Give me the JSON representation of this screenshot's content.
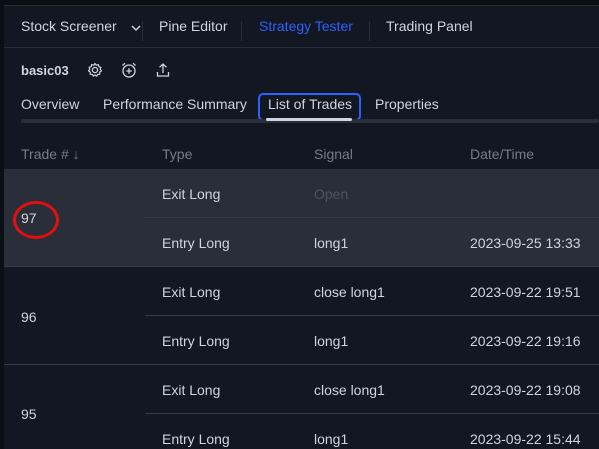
{
  "topnav": {
    "items": [
      {
        "label": "Stock Screener",
        "has_dropdown": true,
        "active": false
      },
      {
        "label": "Pine Editor",
        "active": false
      },
      {
        "label": "Strategy Tester",
        "active": true
      },
      {
        "label": "Trading Panel",
        "active": false
      }
    ],
    "active_color": "#2962ff"
  },
  "strategy": {
    "name": "basic03",
    "icons": [
      "settings-gear-icon",
      "alarm-clock-plus-icon",
      "share-upload-icon"
    ]
  },
  "tabs": [
    {
      "label": "Overview"
    },
    {
      "label": "Performance Summary"
    },
    {
      "label": "List of Trades",
      "active": true
    },
    {
      "label": "Properties"
    }
  ],
  "table": {
    "columns": [
      "Trade # ↓",
      "Type",
      "Signal",
      "Date/Time"
    ],
    "trades": [
      {
        "number": "97",
        "highlighted": true,
        "rows": [
          {
            "type": "Exit Long",
            "signal": "Open",
            "datetime": ""
          },
          {
            "type": "Entry Long",
            "signal": "long1",
            "datetime": "2023-09-25 13:33"
          }
        ]
      },
      {
        "number": "96",
        "rows": [
          {
            "type": "Exit Long",
            "signal": "close long1",
            "datetime": "2023-09-22 19:51"
          },
          {
            "type": "Entry Long",
            "signal": "long1",
            "datetime": "2023-09-22 19:16"
          }
        ]
      },
      {
        "number": "95",
        "rows": [
          {
            "type": "Exit Long",
            "signal": "close long1",
            "datetime": "2023-09-22 19:08"
          },
          {
            "type": "Entry Long",
            "signal": "long1",
            "datetime": "2023-09-22 15:44"
          }
        ]
      }
    ]
  },
  "annotation": {
    "color": "#e01010",
    "marks": "trade 97"
  }
}
